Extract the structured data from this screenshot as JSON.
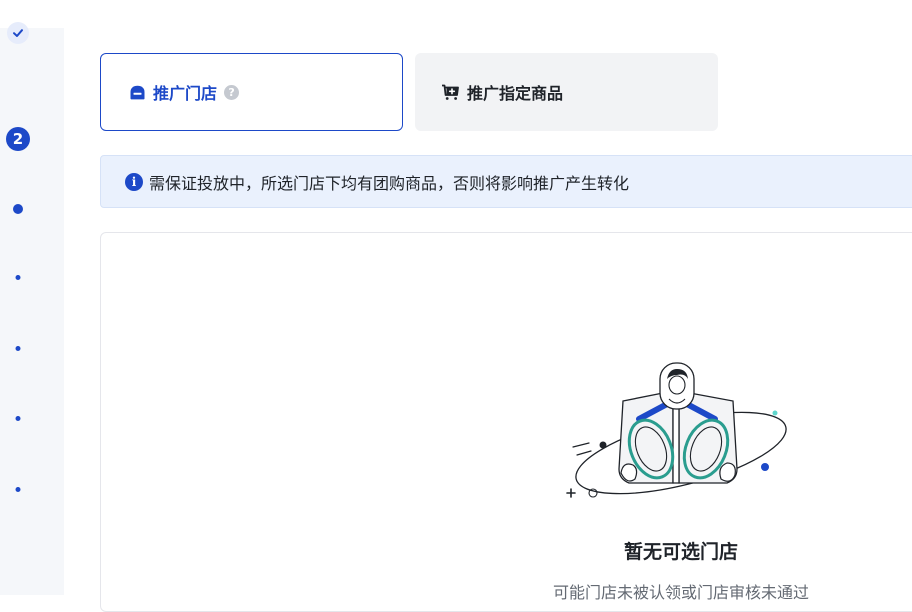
{
  "steps": {
    "completed_icon": "check-icon",
    "current_number": "2",
    "upcoming_count": 5
  },
  "tabs": [
    {
      "label": "推广门店",
      "icon": "store-icon",
      "help_icon": "question-circle-icon",
      "selected": true
    },
    {
      "label": "推广指定商品",
      "icon": "cart-plus-icon",
      "selected": false
    }
  ],
  "notice": {
    "icon": "info-circle-icon",
    "text": "需保证投放中，所选门店下均有团购商品，否则将影响推广产生转化"
  },
  "empty_state": {
    "illustration": "astronaut-illustration",
    "title": "暂无可选门店",
    "subtitle": "可能门店未被认领或门店审核未通过"
  },
  "colors": {
    "accent": "#1d49c8",
    "notice_bg": "#eaf1fd",
    "tab_inactive_bg": "#f2f3f5",
    "rail_bg": "#f5f7fa"
  }
}
